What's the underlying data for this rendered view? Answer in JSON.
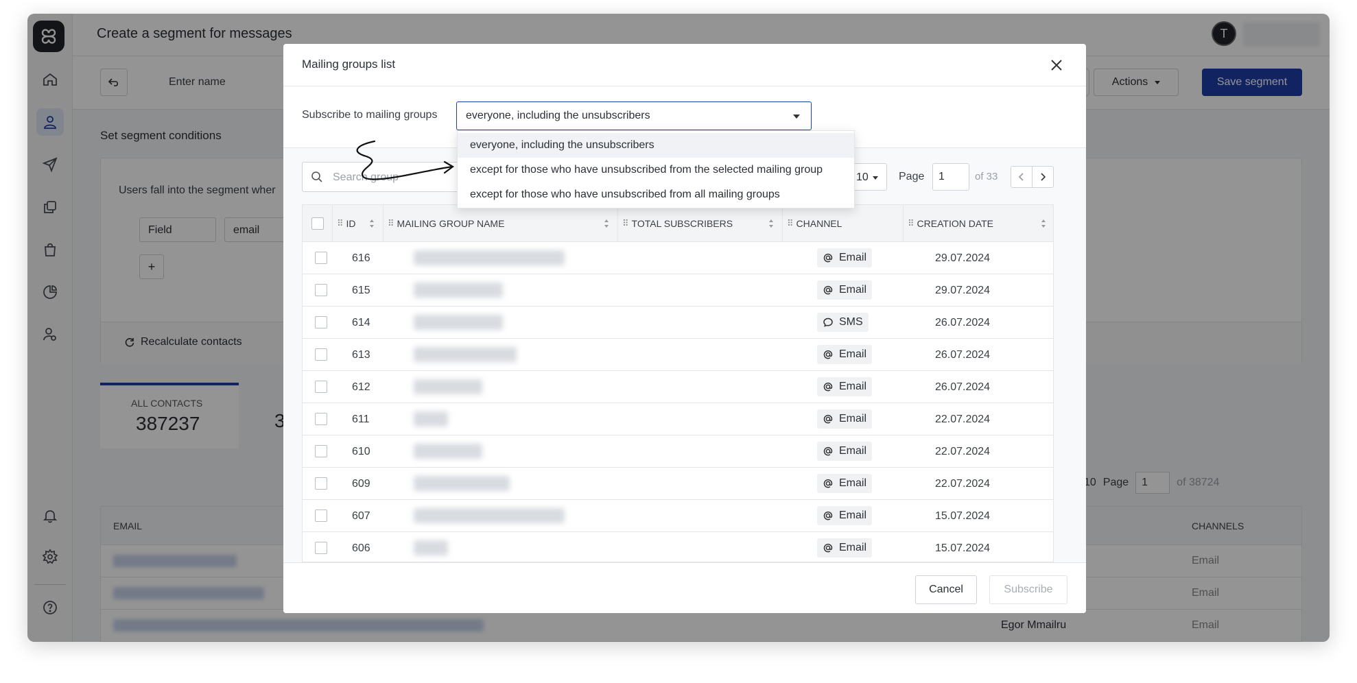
{
  "header": {
    "title": "Create a segment for messages",
    "avatar_initial": "T"
  },
  "toolbar": {
    "name_placeholder": "Enter name",
    "actions_label": "Actions",
    "save_label": "Save segment"
  },
  "conditions": {
    "title": "Set segment conditions",
    "intro": "Users fall into the segment wher",
    "field_select": "Field",
    "field_value": "email",
    "add_label": "+",
    "recalculate_label": "Recalculate contacts"
  },
  "stats": {
    "all_label": "ALL CONTACTS",
    "all_value": "387237",
    "next_value_partial": "3"
  },
  "bottom_pager": {
    "per_page": "10",
    "page_label": "Page",
    "page": "1",
    "of": "of 38724"
  },
  "bottom_table": {
    "col_email": "EMAIL",
    "col_channels": "CHANNELS",
    "rows": [
      {
        "channel": "Email",
        "name": ""
      },
      {
        "channel": "Email",
        "name": ""
      },
      {
        "channel": "Email",
        "name": "Egor Mmailru"
      }
    ]
  },
  "modal": {
    "title": "Mailing groups list",
    "subscribe_label": "Subscribe to mailing groups",
    "subscribe_value": "everyone, including the unsubscribers",
    "options": [
      "everyone, including the unsubscribers",
      "except for those who have unsubscribed from the selected mailing group",
      "except for those who have unsubscribed from all mailing groups"
    ],
    "search_placeholder": "Search group",
    "per_page": "10",
    "page_label": "Page",
    "page": "1",
    "page_of": "of 33",
    "columns": {
      "id": "ID",
      "name": "MAILING GROUP NAME",
      "total": "TOTAL SUBSCRIBERS",
      "channel": "CHANNEL",
      "date": "CREATION DATE"
    },
    "rows": [
      {
        "id": "616",
        "channel": "Email",
        "channel_icon": "at-icon",
        "date": "29.07.2024"
      },
      {
        "id": "615",
        "channel": "Email",
        "channel_icon": "at-icon",
        "date": "29.07.2024"
      },
      {
        "id": "614",
        "channel": "SMS",
        "channel_icon": "chat-icon",
        "date": "26.07.2024"
      },
      {
        "id": "613",
        "channel": "Email",
        "channel_icon": "at-icon",
        "date": "26.07.2024"
      },
      {
        "id": "612",
        "channel": "Email",
        "channel_icon": "at-icon",
        "date": "26.07.2024"
      },
      {
        "id": "611",
        "channel": "Email",
        "channel_icon": "at-icon",
        "date": "22.07.2024"
      },
      {
        "id": "610",
        "channel": "Email",
        "channel_icon": "at-icon",
        "date": "22.07.2024"
      },
      {
        "id": "609",
        "channel": "Email",
        "channel_icon": "at-icon",
        "date": "22.07.2024"
      },
      {
        "id": "607",
        "channel": "Email",
        "channel_icon": "at-icon",
        "date": "15.07.2024"
      },
      {
        "id": "606",
        "channel": "Email",
        "channel_icon": "at-icon",
        "date": "15.07.2024"
      }
    ],
    "cancel_label": "Cancel",
    "subscribe_button": "Subscribe"
  },
  "colors": {
    "primary": "#1e3fa8",
    "overlay": "rgba(0,0,0,0.42)",
    "sidebar_active": "#dfe6f5"
  }
}
